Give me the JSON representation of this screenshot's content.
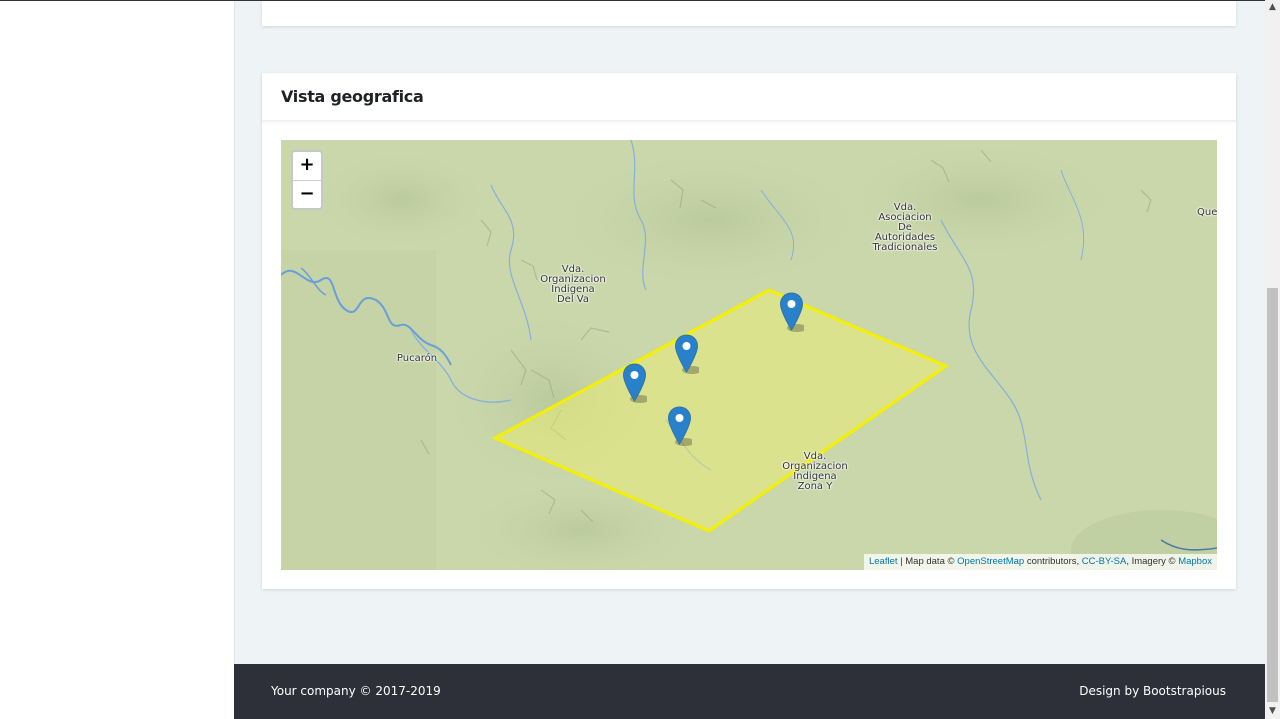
{
  "card": {
    "title": "Vista geografica"
  },
  "map": {
    "zoom_in": "+",
    "zoom_out": "−",
    "labels": [
      {
        "id": "vda-asociacion",
        "lines": [
          "Vda.",
          "Asociacion",
          "De",
          "Autoridades",
          "Tradicionales"
        ]
      },
      {
        "id": "vda-organizacion-delva",
        "lines": [
          "Vda.",
          "Organizacion",
          "Indigena",
          "Del Va"
        ]
      },
      {
        "id": "pucaron",
        "lines": [
          "Pucarón"
        ]
      },
      {
        "id": "vda-organizacion-zonay",
        "lines": [
          "Vda.",
          "Organizacion",
          "Indigena",
          "Zona Y"
        ]
      },
      {
        "id": "que",
        "lines": [
          "Que"
        ]
      }
    ],
    "polygon_color": "#f5f000",
    "marker_color": "#2a81cb",
    "attribution": {
      "leaflet": "Leaflet",
      "sep1": " | Map data © ",
      "osm": "OpenStreetMap",
      "contributors": " contributors, ",
      "license": "CC-BY-SA",
      "imagery": ", Imagery © ",
      "mapbox": "Mapbox"
    }
  },
  "footer": {
    "left": "Your company © 2017-2019",
    "right": "Design by Bootstrapious"
  },
  "scrollbar": {
    "up": "▲",
    "down": "▼"
  }
}
